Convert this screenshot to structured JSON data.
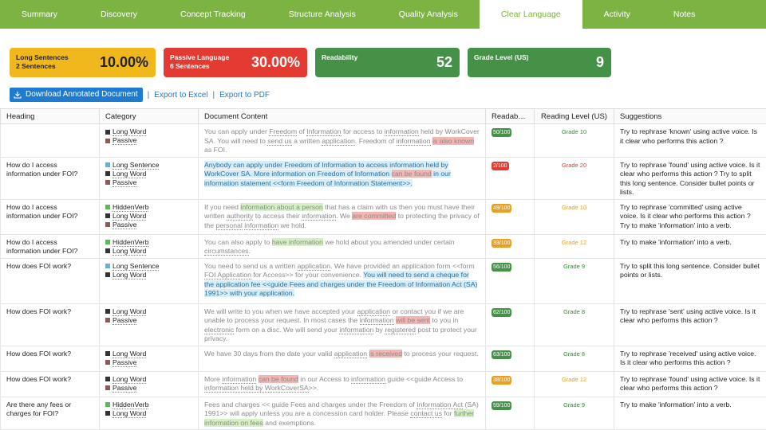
{
  "tabs": [
    "Summary",
    "Discovery",
    "Concept Tracking",
    "Structure Analysis",
    "Quality Analysis",
    "Clear Language",
    "Activity",
    "Notes"
  ],
  "active_tab": "Clear Language",
  "cards": [
    {
      "label": "Long Sentences\n2 Sentences",
      "value": "10.00%",
      "color": "#f1b81e"
    },
    {
      "label": "Passive Language\n6 Sentences",
      "value": "30.00%",
      "color": "#e33b32"
    },
    {
      "label": "Readability",
      "value": "52",
      "color": "#459148"
    },
    {
      "label": "Grade Level (US)",
      "value": "9",
      "color": "#459148"
    }
  ],
  "actions": {
    "download": "Download Annotated Document",
    "excel": "Export to Excel",
    "pdf": "Export to PDF",
    "sep": "|"
  },
  "columns": [
    "Heading",
    "Category",
    "Document Content",
    "Readab…",
    "Reading Level (US)",
    "Suggestions"
  ],
  "rows": [
    {
      "heading": "",
      "cats": [
        {
          "t": "Long Word",
          "c": "#333"
        },
        {
          "t": "Passive",
          "c": "#8d5a5a"
        }
      ],
      "content": [
        {
          "t": "You can apply under "
        },
        {
          "t": "Freedom",
          "u": 1
        },
        {
          "t": " of "
        },
        {
          "t": "Information",
          "u": 1
        },
        {
          "t": " for access to "
        },
        {
          "t": "information",
          "u": 1
        },
        {
          "t": " held by WorkCover SA. You will need to "
        },
        {
          "t": "send us",
          "u": 1
        },
        {
          "t": " a written "
        },
        {
          "t": "application",
          "u": 1
        },
        {
          "t": ". Freedom of "
        },
        {
          "t": "information",
          "u": 1
        },
        {
          "t": " "
        },
        {
          "t": "is also known",
          "h": "red"
        },
        {
          "t": " as FOI."
        }
      ],
      "score": "50/100",
      "score_color": "#459148",
      "grade": "Grade 10",
      "grade_color": "#2e8b2e",
      "suggest": "Try to rephrase 'known' using active voice. Is it clear who performs this action ?"
    },
    {
      "heading": "How do I access information under FOI?",
      "cats": [
        {
          "t": "Long Sentence",
          "c": "#6baed6"
        },
        {
          "t": "Long Word",
          "c": "#333"
        },
        {
          "t": "Passive",
          "c": "#8d5a5a"
        }
      ],
      "content": [
        {
          "t": "Anybody can apply under Freedom of Information to access information held by WorkCover SA. More information on Freedom of Information ",
          "h": "blue"
        },
        {
          "t": "can be found",
          "h": "red"
        },
        {
          "t": " in our information statement <<form Freedom of Information Statement>>.",
          "h": "blue"
        }
      ],
      "score": "2/100",
      "score_color": "#e33b32",
      "grade": "Grade 20",
      "grade_color": "#e33b32",
      "suggest": "Try to rephrase 'found' using active voice. Is it clear who performs this action ? Try to split this long sentence. Consider bullet points or lists."
    },
    {
      "heading": "How do I access information under FOI?",
      "cats": [
        {
          "t": "HiddenVerb",
          "c": "#5cb85c"
        },
        {
          "t": "Long Word",
          "c": "#333"
        },
        {
          "t": "Passive",
          "c": "#8d5a5a"
        }
      ],
      "content": [
        {
          "t": "If you need "
        },
        {
          "t": "information about a person",
          "h": "green"
        },
        {
          "t": " that has a claim with us then you must have their written "
        },
        {
          "t": "authority",
          "u": 1
        },
        {
          "t": " to access their "
        },
        {
          "t": "information",
          "u": 1
        },
        {
          "t": ". We "
        },
        {
          "t": "are committed",
          "h": "red"
        },
        {
          "t": " to protecting the privacy of the "
        },
        {
          "t": "personal",
          "u": 1
        },
        {
          "t": " "
        },
        {
          "t": "information",
          "u": 1
        },
        {
          "t": " we hold."
        }
      ],
      "score": "49/100",
      "score_color": "#e8a020",
      "grade": "Grade 10",
      "grade_color": "#e8a020",
      "suggest": "Try to rephrase 'committed' using active voice. Is it clear who performs this action ? Try to make 'information' into a verb."
    },
    {
      "heading": "How do I access information under FOI?",
      "cats": [
        {
          "t": "HiddenVerb",
          "c": "#5cb85c"
        },
        {
          "t": "Long Word",
          "c": "#333"
        }
      ],
      "content": [
        {
          "t": "You can also apply to "
        },
        {
          "t": "have information",
          "h": "green"
        },
        {
          "t": " we hold about you amended under certain "
        },
        {
          "t": "circumstances",
          "u": 1
        },
        {
          "t": "."
        }
      ],
      "score": "33/100",
      "score_color": "#e8a020",
      "grade": "Grade 12",
      "grade_color": "#e8a020",
      "suggest": "Try to make 'information' into a verb."
    },
    {
      "heading": "How does FOI work?",
      "cats": [
        {
          "t": "Long Sentence",
          "c": "#6baed6"
        },
        {
          "t": "Long Word",
          "c": "#333"
        }
      ],
      "content": [
        {
          "t": "You need to send us a written "
        },
        {
          "t": "application",
          "u": 1
        },
        {
          "t": ". We have provided an application form <<form "
        },
        {
          "t": "FOI Application",
          "u": 1
        },
        {
          "t": " for Access>> for your convenience. "
        },
        {
          "t": "You will need to send a cheque for the application fee <<guide Fees and charges under the Freedom of Information Act (SA) 1991>> with your application.",
          "h": "blue"
        }
      ],
      "score": "56/100",
      "score_color": "#459148",
      "grade": "Grade 9",
      "grade_color": "#2e8b2e",
      "suggest": "Try to split this long sentence. Consider bullet points or lists."
    },
    {
      "heading": "How does FOI work?",
      "cats": [
        {
          "t": "Long Word",
          "c": "#333"
        },
        {
          "t": "Passive",
          "c": "#8d5a5a"
        }
      ],
      "content": [
        {
          "t": "We will write to you when we have accepted your "
        },
        {
          "t": "application",
          "u": 1
        },
        {
          "t": " or contact you if we are unable to process your request. In most cases the "
        },
        {
          "t": "information",
          "u": 1
        },
        {
          "t": " "
        },
        {
          "t": "will be sent",
          "h": "red"
        },
        {
          "t": " to you in "
        },
        {
          "t": "electronic",
          "u": 1
        },
        {
          "t": " form on a disc. We will send your "
        },
        {
          "t": "information",
          "u": 1
        },
        {
          "t": " by "
        },
        {
          "t": "registered",
          "u": 1
        },
        {
          "t": " post to protect your privacy."
        }
      ],
      "score": "62/100",
      "score_color": "#459148",
      "grade": "Grade 8",
      "grade_color": "#2e8b2e",
      "suggest": "Try to rephrase 'sent' using active voice. Is it clear who performs this action ?"
    },
    {
      "heading": "How does FOI work?",
      "cats": [
        {
          "t": "Long Word",
          "c": "#333"
        },
        {
          "t": "Passive",
          "c": "#8d5a5a"
        }
      ],
      "content": [
        {
          "t": "We have 30 days from the date your valid "
        },
        {
          "t": "application",
          "u": 1
        },
        {
          "t": " "
        },
        {
          "t": "is received",
          "h": "red"
        },
        {
          "t": " to process your request."
        }
      ],
      "score": "63/100",
      "score_color": "#459148",
      "grade": "Grade 8",
      "grade_color": "#2e8b2e",
      "suggest": "Try to rephrase 'received' using active voice. Is it clear who performs this action ?"
    },
    {
      "heading": "How does FOI work?",
      "cats": [
        {
          "t": "Long Word",
          "c": "#333"
        },
        {
          "t": "Passive",
          "c": "#8d5a5a"
        }
      ],
      "content": [
        {
          "t": "More "
        },
        {
          "t": "information",
          "u": 1
        },
        {
          "t": " "
        },
        {
          "t": "can be found",
          "h": "red"
        },
        {
          "t": " in our Access to "
        },
        {
          "t": "information",
          "u": 1
        },
        {
          "t": " guide <<guide Access to "
        },
        {
          "t": "information held by WorkCoverSA",
          "u": 1
        },
        {
          "t": ">>."
        }
      ],
      "score": "38/100",
      "score_color": "#e8a020",
      "grade": "Grade 12",
      "grade_color": "#e8a020",
      "suggest": "Try to rephrase 'found' using active voice. Is it clear who performs this action ?"
    },
    {
      "heading": "Are there any fees or charges for FOI?",
      "cats": [
        {
          "t": "HiddenVerb",
          "c": "#5cb85c"
        },
        {
          "t": "Long Word",
          "c": "#333"
        }
      ],
      "content": [
        {
          "t": "Fees and charges << guide Fees and charges under the Freedom of "
        },
        {
          "t": "Information Act",
          "u": 1
        },
        {
          "t": " (SA) 1991>> will apply unless you are a concession card holder. Please "
        },
        {
          "t": "contact us",
          "u": 1
        },
        {
          "t": " for "
        },
        {
          "t": "further information on fees",
          "h": "green"
        },
        {
          "t": " and exemptions."
        }
      ],
      "score": "59/100",
      "score_color": "#459148",
      "grade": "Grade 9",
      "grade_color": "#2e8b2e",
      "suggest": "Try to make 'information' into a verb."
    }
  ]
}
